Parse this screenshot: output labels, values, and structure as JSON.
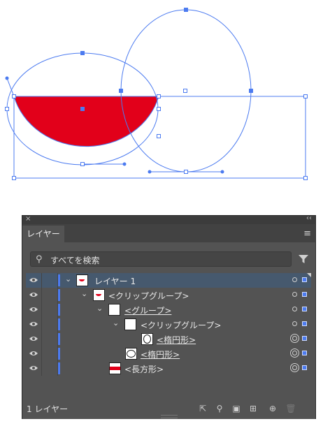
{
  "panel": {
    "tab_label": "レイヤー",
    "search_placeholder": "すべてを検索",
    "footer_count": "1 レイヤー"
  },
  "layers": [
    {
      "name": "レイヤー 1",
      "underline": false,
      "thumb": "layer",
      "selected": true
    },
    {
      "name": "<クリップグループ>",
      "underline": false,
      "thumb": "layer"
    },
    {
      "name": "<グループ>",
      "underline": true,
      "thumb": "blank"
    },
    {
      "name": "<クリップグループ>",
      "underline": false,
      "thumb": "blank"
    },
    {
      "name": "<楕円形>",
      "underline": true,
      "thumb": "ellipse"
    },
    {
      "name": "<楕円形>",
      "underline": true,
      "thumb": "ellipse"
    },
    {
      "name": "<長方形>",
      "underline": false,
      "thumb": "rect"
    }
  ],
  "colors": {
    "fill_red": "#e2001a",
    "selection_blue": "#4c7bf0",
    "panel_bg": "#535353"
  },
  "icons": {
    "eye": "eye-icon",
    "search": "search-icon",
    "filter": "filter-icon",
    "menu": "panel-menu-icon"
  }
}
